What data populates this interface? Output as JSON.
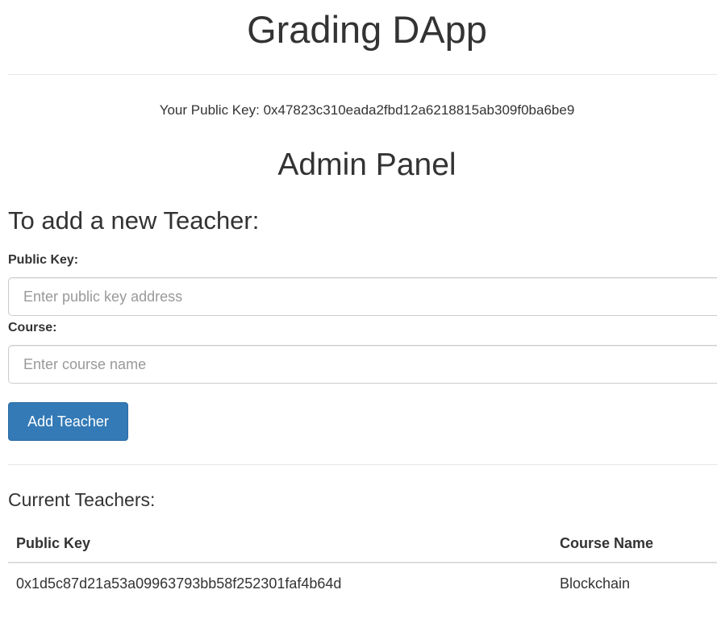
{
  "header": {
    "title": "Grading DApp",
    "public_key_label": "Your Public Key:",
    "public_key_value": "0x47823c310eada2fbd12a6218815ab309f0ba6be9"
  },
  "admin_panel": {
    "title": "Admin Panel",
    "add_teacher": {
      "heading": "To add a new Teacher:",
      "public_key_label": "Public Key:",
      "public_key_placeholder": "Enter public key address",
      "public_key_value": "",
      "course_label": "Course:",
      "course_placeholder": "Enter course name",
      "course_value": "",
      "submit_label": "Add Teacher"
    },
    "current_teachers": {
      "heading": "Current Teachers:",
      "columns": [
        "Public Key",
        "Course Name"
      ],
      "rows": [
        [
          "0x1d5c87d21a53a09963793bb58f252301faf4b64d",
          "Blockchain"
        ]
      ]
    }
  },
  "colors": {
    "primary_button": "#337ab7",
    "text": "#333333",
    "border": "#cccccc"
  }
}
